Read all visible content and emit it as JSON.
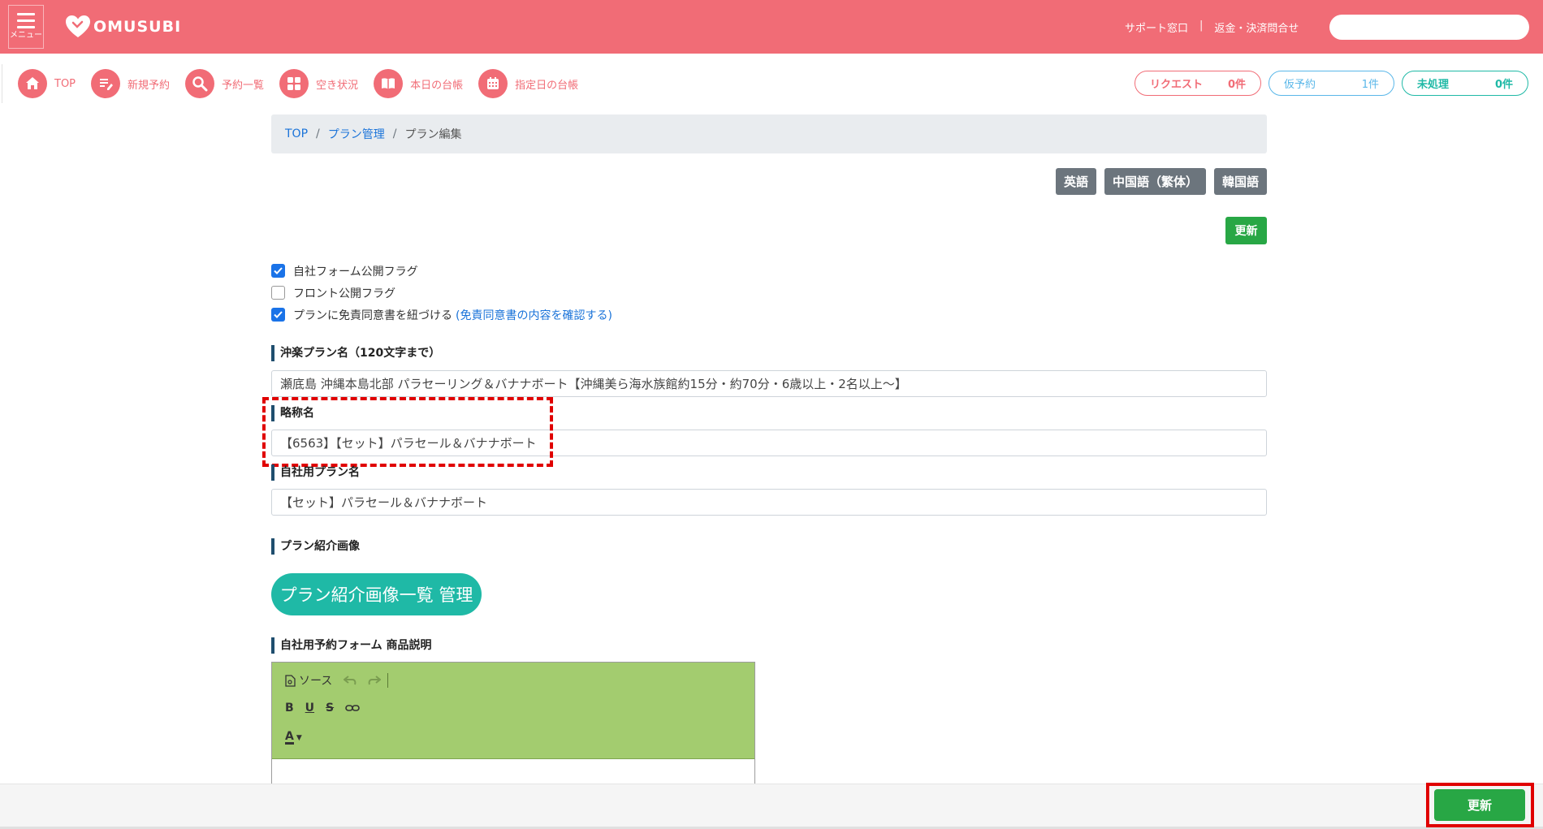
{
  "header": {
    "menu_label": "メニュー",
    "logo_text": "OMUSUBI",
    "support_link": "サポート窓口",
    "separator": "|",
    "refund_link": "返金・決済問合せ",
    "search_value": ""
  },
  "nav": {
    "items": [
      {
        "label": "TOP",
        "icon": "home-icon"
      },
      {
        "label": "新規予約",
        "icon": "new-reservation-icon"
      },
      {
        "label": "予約一覧",
        "icon": "search-icon"
      },
      {
        "label": "空き状況",
        "icon": "grid-icon"
      },
      {
        "label": "本日の台帳",
        "icon": "book-icon"
      },
      {
        "label": "指定日の台帳",
        "icon": "calendar-icon"
      }
    ],
    "pills": [
      {
        "label": "リクエスト",
        "count": "0件",
        "color": "#f16c76"
      },
      {
        "label": "仮予約",
        "count": "1件",
        "color": "#5ab7e9"
      },
      {
        "label": "未処理",
        "count": "0件",
        "color": "#1fb9a6"
      }
    ]
  },
  "breadcrumb": {
    "top": "TOP",
    "sep": "/",
    "plan_mgmt": "プラン管理",
    "current": "プラン編集"
  },
  "languages": [
    "英語",
    "中国語（繁体）",
    "韓国語"
  ],
  "actions": {
    "update_label": "更新"
  },
  "checkboxes": [
    {
      "label": "自社フォーム公開フラグ",
      "checked": true
    },
    {
      "label": "フロント公開フラグ",
      "checked": false
    },
    {
      "label": "プランに免責同意書を紐づける",
      "checked": true,
      "link": "(免責同意書の内容を確認する)"
    }
  ],
  "fields": {
    "plan_name_label": "沖楽プラン名（120文字まで）",
    "plan_name_value": "瀬底島 沖縄本島北部 パラセーリング＆バナナボート【沖縄美ら海水族館約15分・約70分・6歳以上・2名以上〜】",
    "short_name_label": "略称名",
    "short_name_value": "【6563】【セット】パラセール＆バナナボート",
    "own_plan_label": "自社用プラン名",
    "own_plan_value": "【セット】パラセール＆バナナボート",
    "image_label": "プラン紹介画像",
    "image_mgr_button": "プラン紹介画像一覧 管理",
    "description_label": "自社用予約フォーム 商品説明"
  },
  "editor": {
    "source_label": "ソース",
    "bold": "B",
    "underline": "U",
    "strike": "S",
    "font_color": "A"
  }
}
